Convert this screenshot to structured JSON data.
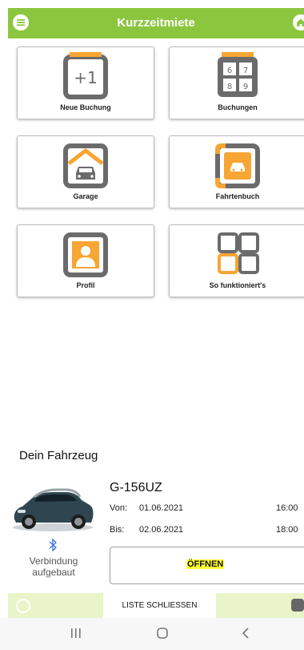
{
  "header": {
    "title": "Kurzzeitmiete",
    "color": "#8cc63f",
    "menu_icon": "menu-icon",
    "home_icon": "home-icon"
  },
  "tiles": [
    {
      "label": "Neue Buchung",
      "icon": "plus-one-icon"
    },
    {
      "label": "Buchungen",
      "icon": "calendar-grid-icon",
      "icon_text": [
        "6",
        "7",
        "8",
        "9"
      ]
    },
    {
      "label": "Garage",
      "icon": "garage-icon"
    },
    {
      "label": "Fahrtenbuch",
      "icon": "logbook-car-icon"
    },
    {
      "label": "Profil",
      "icon": "profile-icon"
    },
    {
      "label": "So funktioniert's",
      "icon": "how-it-works-icon"
    }
  ],
  "tile_plus_text": "+1",
  "vehicle": {
    "section_title": "Dein Fahrzeug",
    "plate": "G-156UZ",
    "from_label": "Von:",
    "from_date": "01.06.2021",
    "from_time": "16:00",
    "to_label": "Bis:",
    "to_date": "02.06.2021",
    "to_time": "18:00",
    "connection_status": "Verbindung aufgebaut",
    "open_button": "ÖFFNEN"
  },
  "bottom_bar": {
    "close_list": "LISTE SCHLIESSEN"
  },
  "colors": {
    "accent": "#8cc63f",
    "orange": "#f7a533",
    "gray": "#6b6b6b",
    "highlight": "#ffff33"
  }
}
